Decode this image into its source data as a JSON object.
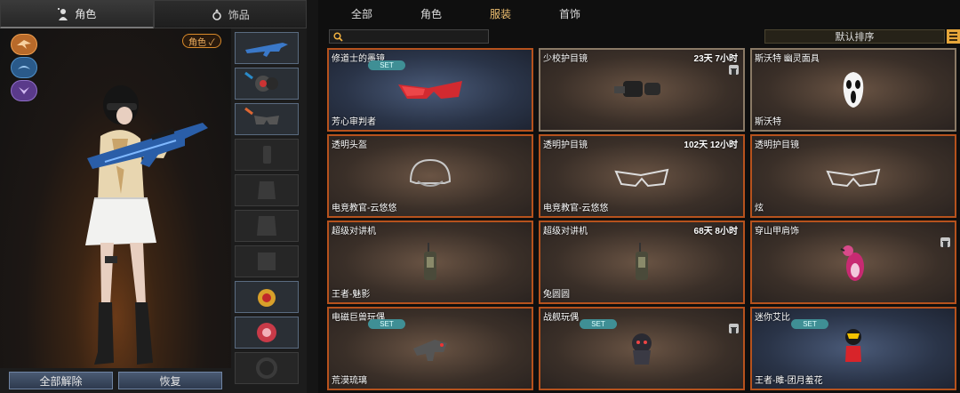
{
  "left_tabs": [
    {
      "label": "角色",
      "icon": "character-icon"
    },
    {
      "label": "饰品",
      "icon": "ring-icon"
    }
  ],
  "role_badge": "角色 ✓",
  "bottom_buttons": {
    "unequip_all": "全部解除",
    "restore": "恢复"
  },
  "right_tabs": [
    "全部",
    "角色",
    "服装",
    "首饰"
  ],
  "active_right_tab": "服装",
  "search": {
    "placeholder": ""
  },
  "sort_label": "默认排序",
  "items": [
    {
      "name": "修道士的墨镜",
      "time": "",
      "owner": "芳心审判者",
      "set": "SET",
      "trash": false
    },
    {
      "name": "少校护目镜",
      "time": "23天  7小时",
      "owner": "",
      "set": "",
      "trash": true
    },
    {
      "name": "斯沃特 幽灵面具",
      "time": "",
      "owner": "斯沃特",
      "set": "",
      "trash": false
    },
    {
      "name": "透明头盔",
      "time": "",
      "owner": "电竞教官-云悠悠",
      "set": "",
      "trash": false
    },
    {
      "name": "透明护目镜",
      "time": "102天  12小时",
      "owner": "电竞教官-云悠悠",
      "set": "",
      "trash": false
    },
    {
      "name": "透明护目镜",
      "time": "",
      "owner": "炫",
      "set": "",
      "trash": false
    },
    {
      "name": "超级对讲机",
      "time": "",
      "owner": "王者-魅影",
      "set": "",
      "trash": false
    },
    {
      "name": "超级对讲机",
      "time": "68天  8小时",
      "owner": "兔圆圆",
      "set": "",
      "trash": false
    },
    {
      "name": "穿山甲肩饰",
      "time": "",
      "owner": "",
      "set": "",
      "trash": true
    },
    {
      "name": "电磁巨兽玩偶",
      "time": "",
      "owner": "荒漠琉璃",
      "set": "SET",
      "trash": false
    },
    {
      "name": "战舰玩偶",
      "time": "",
      "owner": "",
      "set": "SET",
      "trash": true
    },
    {
      "name": "迷你艾比",
      "time": "",
      "owner": "王者-雎-团月羞花",
      "set": "SET",
      "trash": false
    }
  ]
}
